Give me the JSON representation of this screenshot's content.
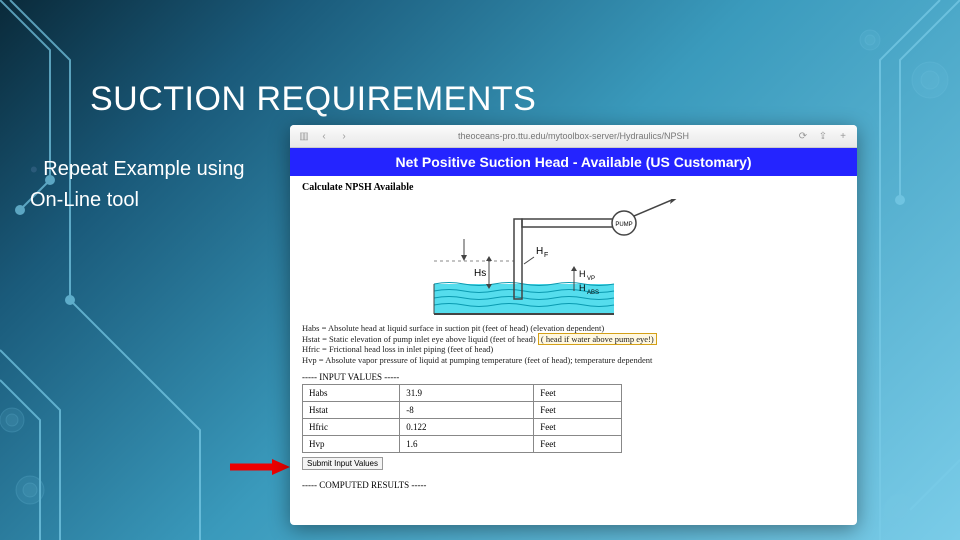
{
  "title": "SUCTION REQUIREMENTS",
  "bullet": "Repeat Example using On-Line tool",
  "browser": {
    "url": "theoceans-pro.ttu.edu/mytoolbox-server/Hydraulics/NPSH",
    "back": "‹",
    "fwd": "›",
    "reload": "⟳",
    "share": "⇪",
    "plus": "+"
  },
  "page": {
    "banner": "Net Positive Suction Head - Available (US Customary)",
    "subtitle": "Calculate NPSH Available",
    "diagram_labels": {
      "hs": "Hs",
      "hf": "HF",
      "hvp": "HVP",
      "habs": "HABS",
      "pump": "PUMP"
    },
    "defs": [
      "Habs = Absolute head at liquid surface in suction pit (feet of head) (elevation dependent)",
      "Hstat = Static elevation of pump inlet eye above liquid (feet of head) ( head if water above pump eye!)",
      "Hfric = Frictional head loss in inlet piping (feet of head)",
      "Hvp = Absolute vapor pressure of liquid at pumping temperature (feet of head); temperature dependent"
    ],
    "input_header": "----- INPUT VALUES -----",
    "inputs": [
      {
        "name": "Habs",
        "value": "31.9",
        "unit": "Feet"
      },
      {
        "name": "Hstat",
        "value": "-8",
        "unit": "Feet"
      },
      {
        "name": "Hfric",
        "value": "0.122",
        "unit": "Feet"
      },
      {
        "name": "Hvp",
        "value": "1.6",
        "unit": "Feet"
      }
    ],
    "submit": "Submit Input Values",
    "results_header": "----- COMPUTED RESULTS -----"
  }
}
